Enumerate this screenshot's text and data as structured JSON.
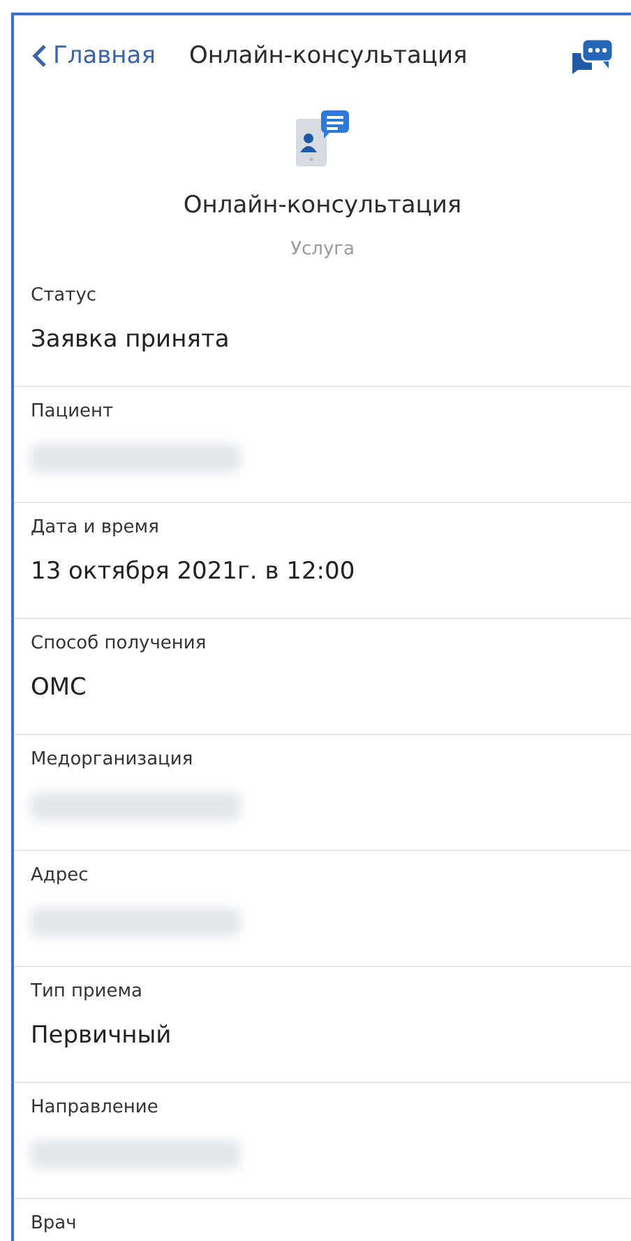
{
  "nav": {
    "back": "Главная",
    "title": "Онлайн-консультация"
  },
  "service": {
    "title": "Онлайн-консультация",
    "subtitle": "Услуга"
  },
  "fields": [
    {
      "label": "Статус",
      "kind": "text",
      "value": "Заявка принята"
    },
    {
      "label": "Пациент",
      "kind": "redacted"
    },
    {
      "label": "Дата и время",
      "kind": "text",
      "value": "13 октября 2021г. в 12:00"
    },
    {
      "label": "Способ получения",
      "kind": "text",
      "value": "ОМС"
    },
    {
      "label": "Медорганизация",
      "kind": "redacted"
    },
    {
      "label": "Адрес",
      "kind": "redacted"
    },
    {
      "label": "Тип приема",
      "kind": "text",
      "value": "Первичный"
    },
    {
      "label": "Направление",
      "kind": "redacted"
    },
    {
      "label": "Врач",
      "kind": "label-only"
    }
  ]
}
